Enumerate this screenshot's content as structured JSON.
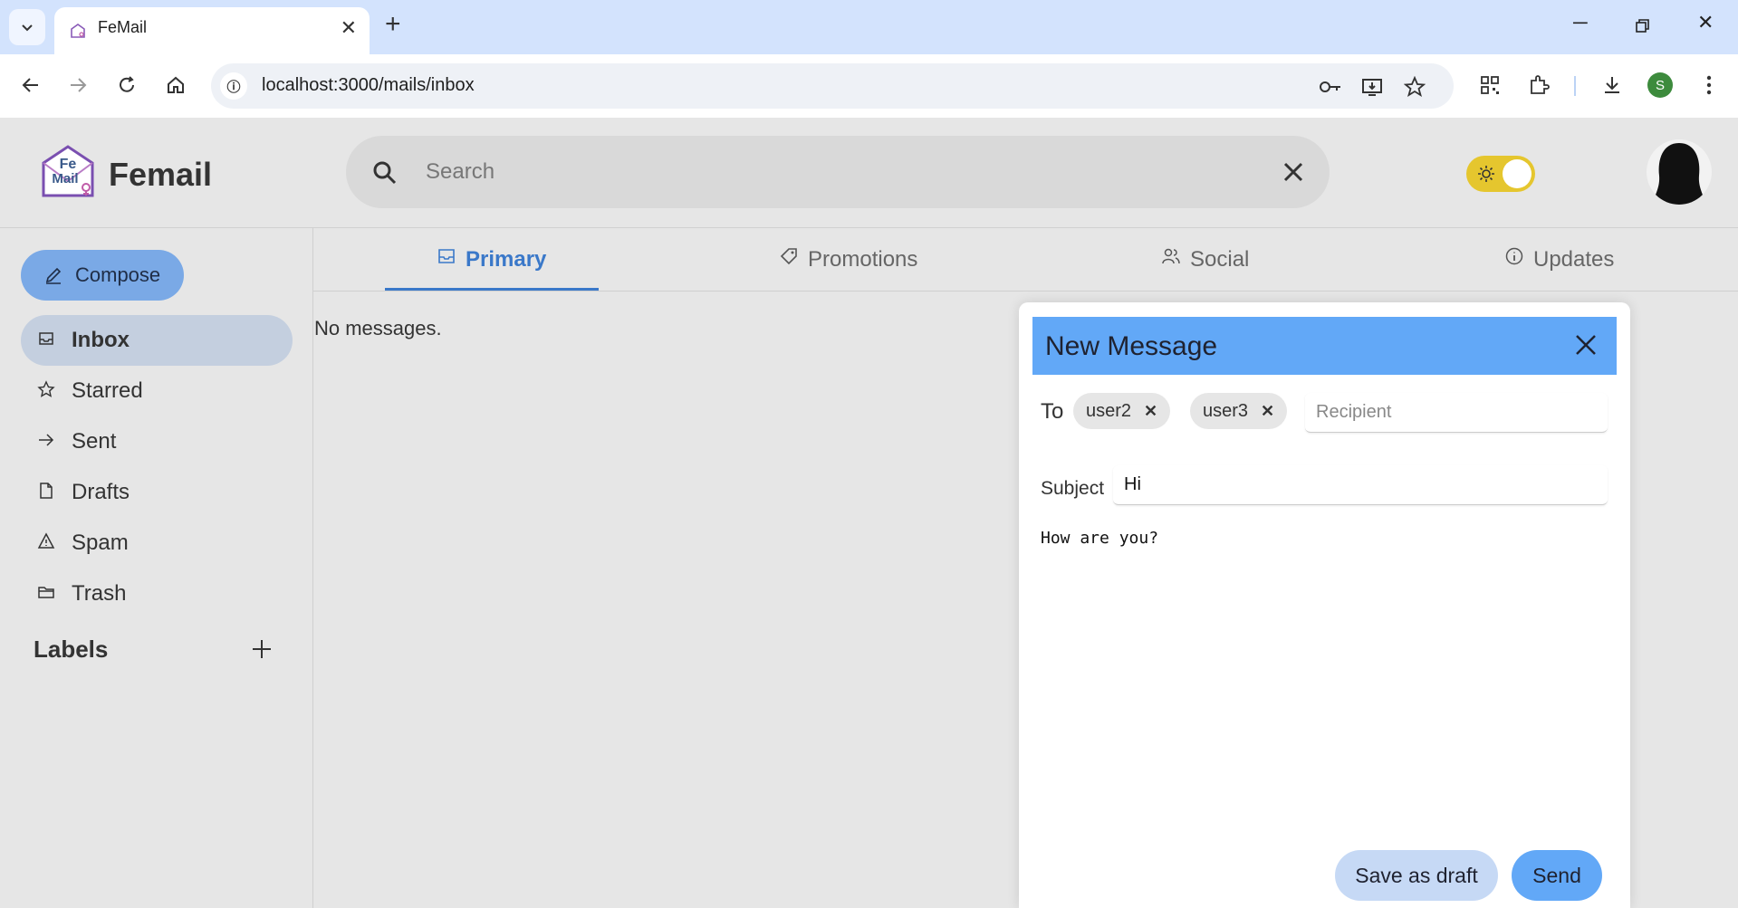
{
  "browser": {
    "tab_title": "FeMail",
    "url": "localhost:3000/mails/inbox",
    "profile_initial": "S"
  },
  "header": {
    "brand": "Femail",
    "logo_text_top": "Fe",
    "logo_text_bottom": "Mail",
    "search_placeholder": "Search",
    "theme_toggle_on": true
  },
  "sidebar": {
    "compose_label": "Compose",
    "items": [
      {
        "label": "Inbox",
        "icon": "inbox-icon",
        "active": true
      },
      {
        "label": "Starred",
        "icon": "star-icon"
      },
      {
        "label": "Sent",
        "icon": "arrow-right-icon"
      },
      {
        "label": "Drafts",
        "icon": "file-icon"
      },
      {
        "label": "Spam",
        "icon": "warning-icon"
      },
      {
        "label": "Trash",
        "icon": "folder-icon"
      }
    ],
    "labels_heading": "Labels"
  },
  "main": {
    "tabs": [
      {
        "label": "Primary",
        "icon": "inbox-icon",
        "active": true
      },
      {
        "label": "Promotions",
        "icon": "tag-icon"
      },
      {
        "label": "Social",
        "icon": "people-icon"
      },
      {
        "label": "Updates",
        "icon": "info-icon"
      }
    ],
    "empty_text": "No messages."
  },
  "compose": {
    "title": "New Message",
    "to_label": "To",
    "recipients": [
      "user2",
      "user3"
    ],
    "recipient_placeholder": "Recipient",
    "subject_label": "Subject",
    "subject_value": "Hi",
    "body_value": "How are you?",
    "save_draft_label": "Save as draft",
    "send_label": "Send"
  },
  "colors": {
    "accent": "#3a78c9",
    "dialog_header": "#62a8f7",
    "toggle": "#e5c62e"
  }
}
